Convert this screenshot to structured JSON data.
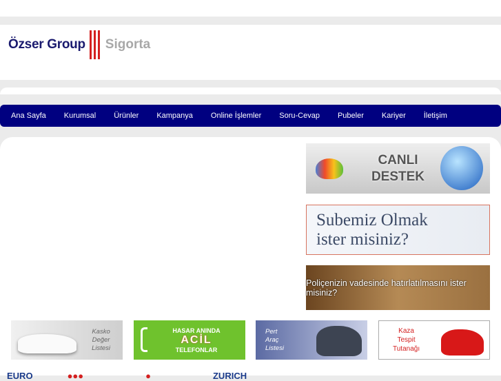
{
  "logo": {
    "name": "Özser Group",
    "suffix": "Sigorta"
  },
  "nav": [
    "Ana Sayfa",
    "Kurumsal",
    "Ürünler",
    "Kampanya",
    "Online İşlemler",
    "Soru-Cevap",
    "Pubeler",
    "Kariyer",
    "İletişim"
  ],
  "banners": {
    "canli": [
      "CANLI",
      "DESTEK"
    ],
    "sube": [
      "Subemiz Olmak",
      "ister misiniz?"
    ],
    "police": "Poliçenizin vadesinde hatırlatılmasını ister misiniz?"
  },
  "tiles": {
    "kasko": [
      "Kasko",
      "Değer",
      "Listesi"
    ],
    "acil": [
      "HASAR ANINDA",
      "ACİL",
      "TELEFONLAR"
    ],
    "pert": [
      "Pert",
      "Araç",
      "Listesi"
    ],
    "kaza": [
      "Kaza",
      "Tespit",
      "Tutanağı"
    ]
  },
  "partners": [
    "EURO",
    "ZURICH"
  ]
}
